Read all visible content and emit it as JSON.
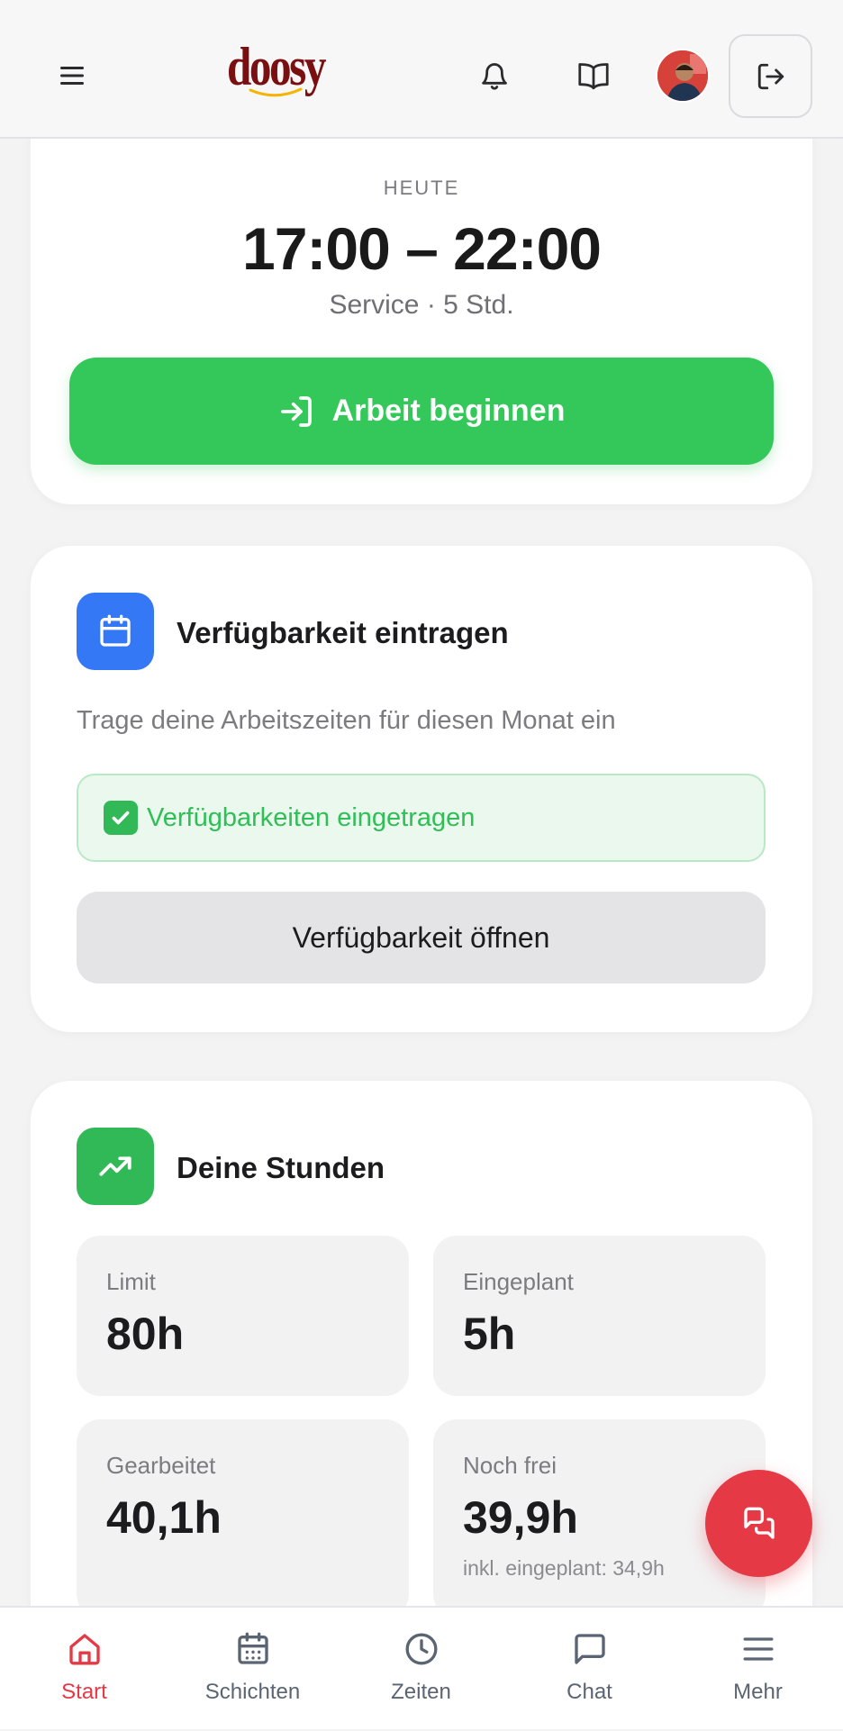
{
  "header": {
    "logo_text": "doosy",
    "icons": [
      "menu-icon",
      "bell-icon",
      "book-open-icon",
      "avatar",
      "logout-icon"
    ]
  },
  "shift": {
    "label": "HEUTE",
    "time": "17:00 – 22:00",
    "subtitle": "Service · 5 Std.",
    "start_button": "Arbeit beginnen"
  },
  "availability": {
    "title": "Verfügbarkeit eintragen",
    "description": "Trage deine Arbeitszeiten für diesen Monat ein",
    "status": "Verfügbarkeiten eingetragen",
    "open_button": "Verfügbarkeit öffnen"
  },
  "hours": {
    "title": "Deine Stunden",
    "stats": [
      {
        "label": "Limit",
        "value": "80h"
      },
      {
        "label": "Eingeplant",
        "value": "5h"
      },
      {
        "label": "Gearbeitet",
        "value": "40,1h"
      },
      {
        "label": "Noch frei",
        "value": "39,9h",
        "note": "inkl. eingeplant: 34,9h"
      }
    ]
  },
  "tabbar": {
    "tabs": [
      {
        "label": "Start",
        "icon": "home-icon",
        "active": true
      },
      {
        "label": "Schichten",
        "icon": "calendar-icon",
        "active": false
      },
      {
        "label": "Zeiten",
        "icon": "clock-icon",
        "active": false
      },
      {
        "label": "Chat",
        "icon": "chat-icon",
        "active": false
      },
      {
        "label": "Mehr",
        "icon": "menu-icon",
        "active": false
      }
    ]
  },
  "colors": {
    "accent_red": "#e63946",
    "start_green": "#34c759",
    "calendar_blue": "#3478f6",
    "hours_green": "#30b956",
    "status_green_text": "#2fbf56"
  }
}
